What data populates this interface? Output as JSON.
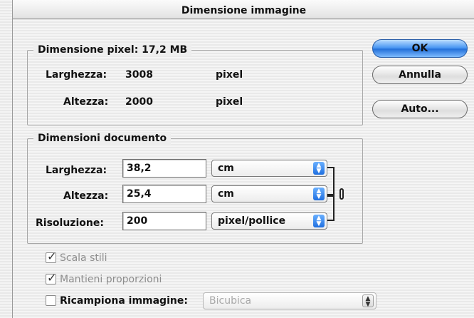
{
  "dialog": {
    "title": "Dimensione immagine"
  },
  "pixel_dimensions": {
    "legend": "Dimensione pixel: 17,2 MB",
    "width": {
      "label": "Larghezza:",
      "value": "3008",
      "unit": "pixel"
    },
    "height": {
      "label": "Altezza:",
      "value": "2000",
      "unit": "pixel"
    }
  },
  "document_size": {
    "legend": "Dimensioni documento",
    "width": {
      "label": "Larghezza:",
      "value": "38,2",
      "unit": "cm"
    },
    "height": {
      "label": "Altezza:",
      "value": "25,4",
      "unit": "cm"
    },
    "resolution": {
      "label": "Risoluzione:",
      "value": "200",
      "unit": "pixel/pollice"
    }
  },
  "buttons": {
    "ok": "OK",
    "cancel": "Annulla",
    "auto": "Auto..."
  },
  "options": {
    "scale_styles": {
      "label": "Scala stili",
      "checked": true
    },
    "constrain": {
      "label": "Mantieni proporzioni",
      "checked": true
    },
    "resample": {
      "label": "Ricampiona immagine:",
      "checked": false,
      "method": "Bicubica"
    }
  }
}
